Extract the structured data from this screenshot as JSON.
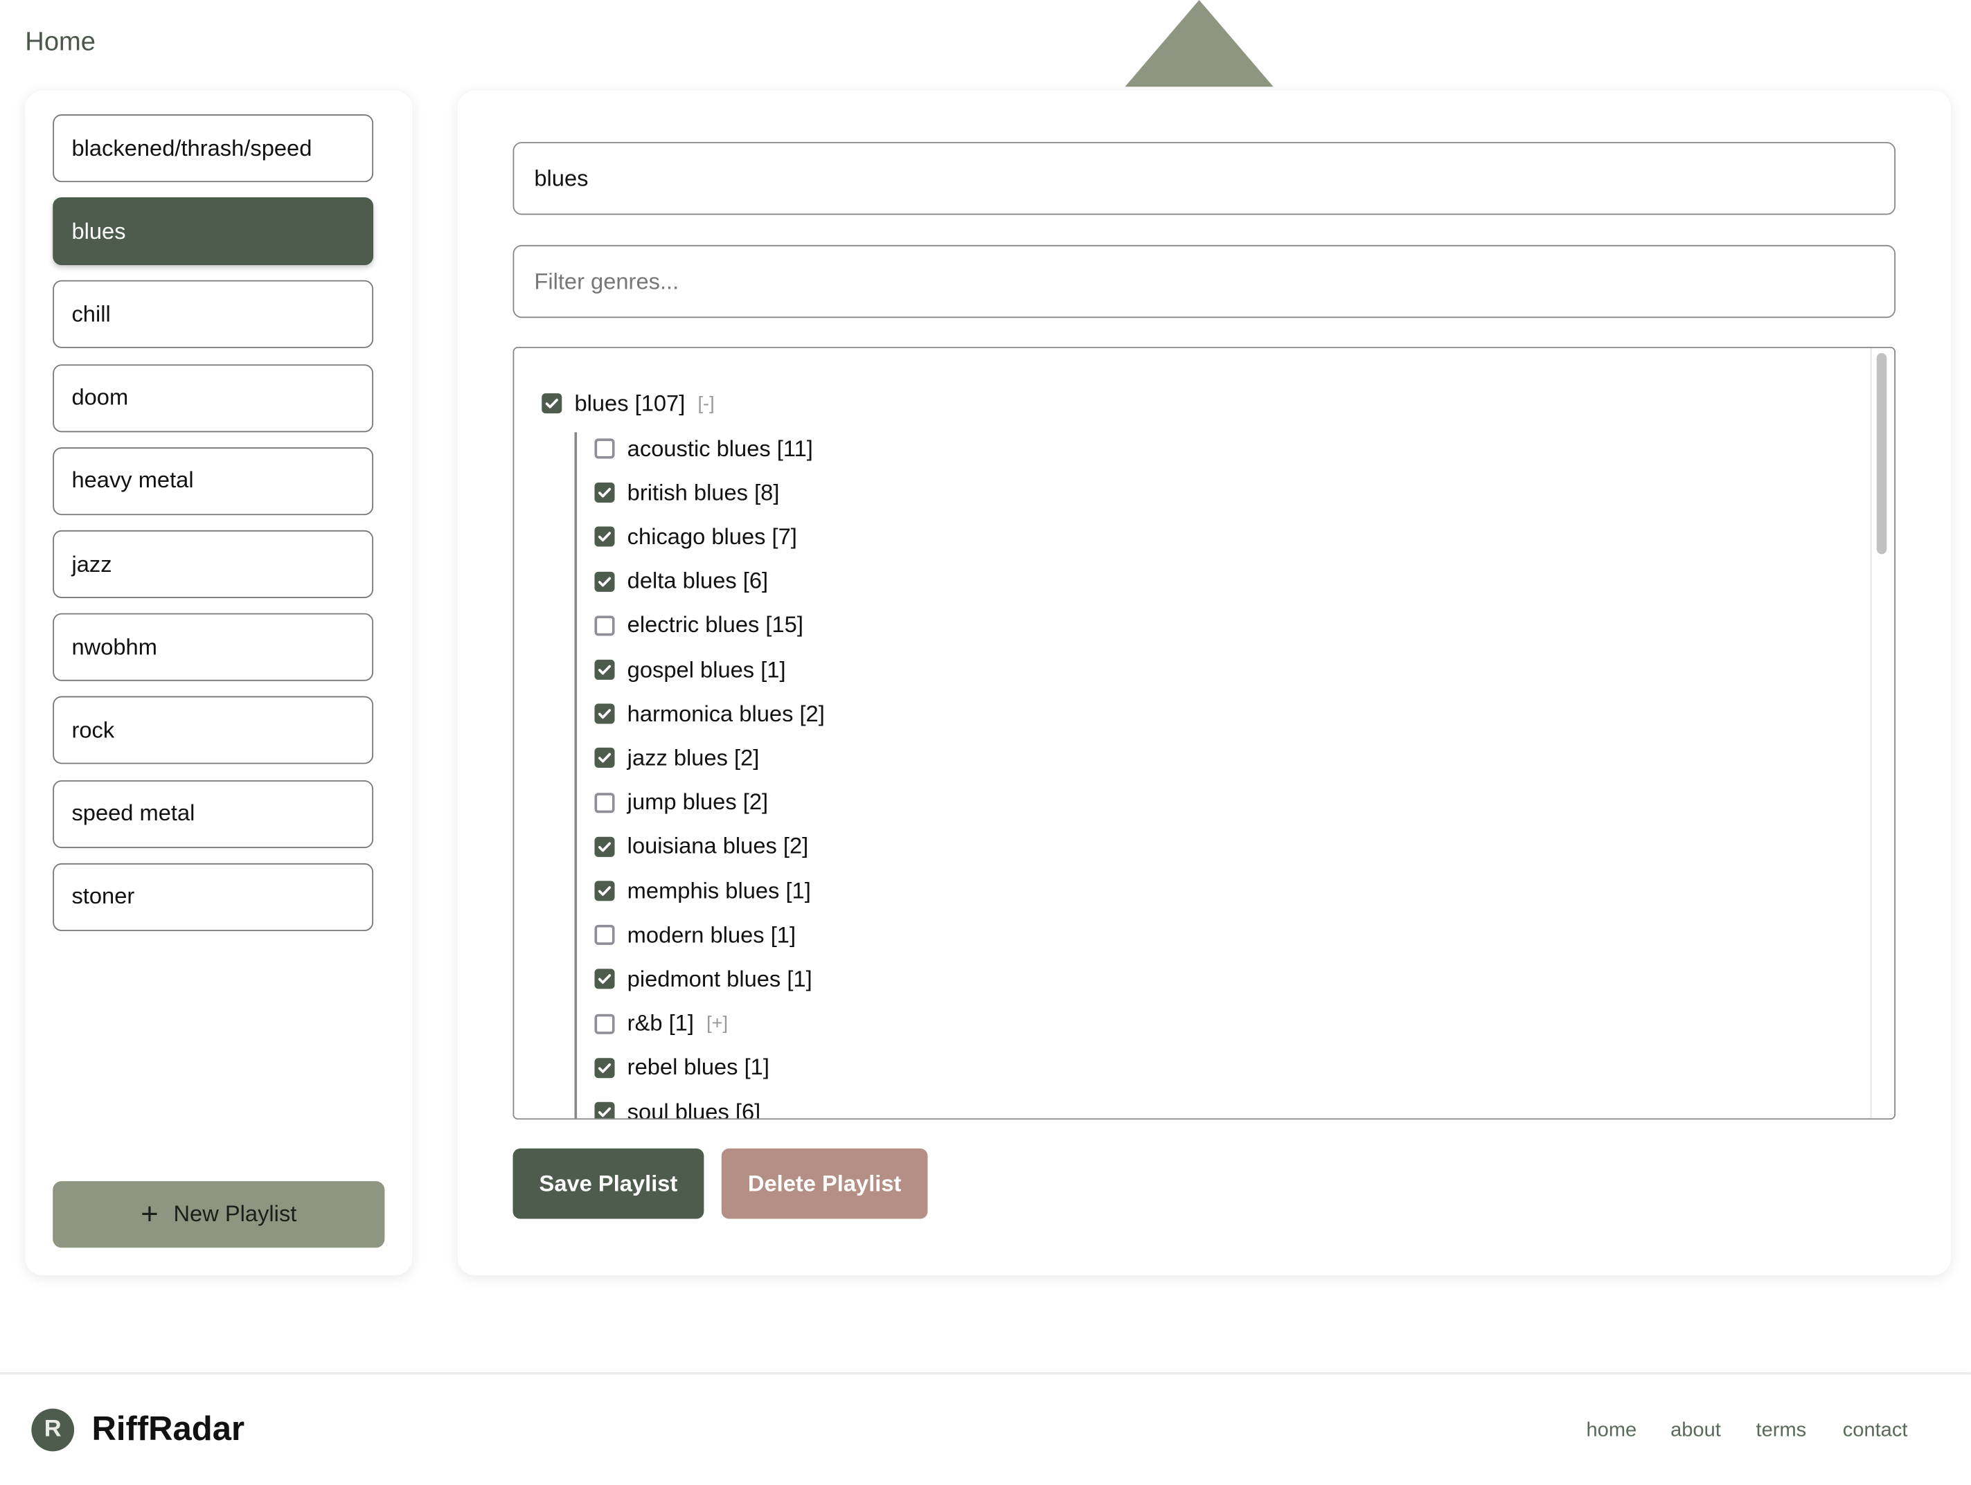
{
  "header": {
    "title": "Home"
  },
  "colors": {
    "primary": "#4d5c4d",
    "accent": "#8e9580",
    "danger": "#b38f85"
  },
  "sidebar": {
    "playlists": [
      {
        "label": "blackened/thrash/speed",
        "selected": false
      },
      {
        "label": "blues",
        "selected": true
      },
      {
        "label": "chill",
        "selected": false
      },
      {
        "label": "doom",
        "selected": false
      },
      {
        "label": "heavy metal",
        "selected": false
      },
      {
        "label": "jazz",
        "selected": false
      },
      {
        "label": "nwobhm",
        "selected": false
      },
      {
        "label": "rock",
        "selected": false
      },
      {
        "label": "speed metal",
        "selected": false
      },
      {
        "label": "stoner",
        "selected": false
      }
    ],
    "new_playlist_label": "New Playlist",
    "new_playlist_icon": "plus-icon"
  },
  "main": {
    "playlist_name_value": "blues",
    "filter_placeholder": "Filter genres...",
    "tree": {
      "root": {
        "label": "blues [107]",
        "checked": true,
        "toggle": "[-]"
      },
      "children": [
        {
          "label": "acoustic blues [11]",
          "checked": false
        },
        {
          "label": "british blues [8]",
          "checked": true
        },
        {
          "label": "chicago blues [7]",
          "checked": true
        },
        {
          "label": "delta blues [6]",
          "checked": true
        },
        {
          "label": "electric blues [15]",
          "checked": false
        },
        {
          "label": "gospel blues [1]",
          "checked": true
        },
        {
          "label": "harmonica blues [2]",
          "checked": true
        },
        {
          "label": "jazz blues [2]",
          "checked": true
        },
        {
          "label": "jump blues [2]",
          "checked": false
        },
        {
          "label": "louisiana blues [2]",
          "checked": true
        },
        {
          "label": "memphis blues [1]",
          "checked": true
        },
        {
          "label": "modern blues [1]",
          "checked": false
        },
        {
          "label": "piedmont blues [1]",
          "checked": true
        },
        {
          "label": "r&b [1]",
          "checked": false,
          "toggle": "[+]"
        },
        {
          "label": "rebel blues [1]",
          "checked": true
        },
        {
          "label": "soul blues [6]",
          "checked": true
        }
      ]
    },
    "save_label": "Save Playlist",
    "delete_label": "Delete Playlist"
  },
  "footer": {
    "brand": "RiffRadar",
    "logo_letter": "R",
    "links": [
      "home",
      "about",
      "terms",
      "contact"
    ]
  }
}
